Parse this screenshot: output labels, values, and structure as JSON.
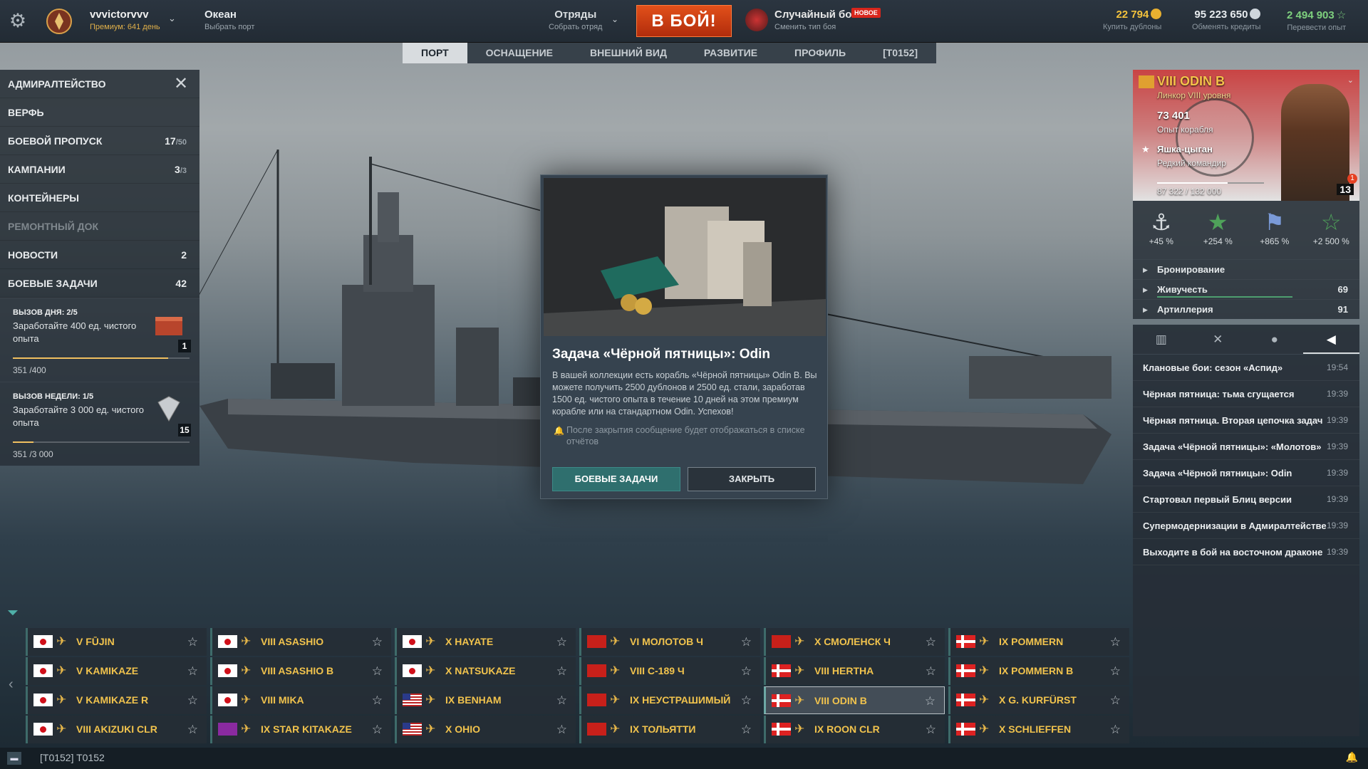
{
  "topbar": {
    "username": "vvvictorvvv",
    "premium": "Премиум: 641 день",
    "map": "Океан",
    "map_sub": "Выбрать порт",
    "division": "Отряды",
    "division_sub": "Собрать отряд",
    "battle": "В БОЙ!",
    "mode": "Случайный бой",
    "mode_sub": "Сменить тип боя",
    "new_badge": "НОВОЕ",
    "doubloons": "22 794",
    "doubloons_sub": "Купить дублоны",
    "credits": "95 223 650",
    "credits_sub": "Обменять кредиты",
    "freexp": "2 494 903",
    "freexp_sub": "Перевести опыт"
  },
  "tabs": [
    "ПОРТ",
    "ОСНАЩЕНИЕ",
    "ВНЕШНИЙ ВИД",
    "РАЗВИТИЕ",
    "ПРОФИЛЬ",
    "[T0152]"
  ],
  "left_menu": {
    "admiralty": "АДМИРАЛТЕЙСТВО",
    "shipyard": "ВЕРФЬ",
    "battlepass": "БОЕВОЙ ПРОПУСК",
    "battlepass_cnt": "17",
    "battlepass_tot": "/50",
    "campaigns": "КАМПАНИИ",
    "campaigns_cnt": "3",
    "campaigns_tot": "/3",
    "containers": "КОНТЕЙНЕРЫ",
    "drydock": "РЕМОНТНЫЙ ДОК",
    "news": "НОВОСТИ",
    "news_cnt": "2",
    "tasks": "БОЕВЫЕ ЗАДАЧИ",
    "tasks_cnt": "42"
  },
  "challenges": [
    {
      "title": "ВЫЗОВ ДНЯ: 2/5",
      "desc": "Заработайте 400 ед. чистого опыта",
      "progress": "351 /400",
      "fraction": 0.8775,
      "level": "1"
    },
    {
      "title": "ВЫЗОВ НЕДЕЛИ: 1/5",
      "desc": "Заработайте 3 000 ед. чистого опыта",
      "progress": "351 /3 000",
      "fraction": 0.117,
      "level": "15"
    }
  ],
  "popup": {
    "title": "Задача «Чёрной пятницы»: Odin",
    "body": "В вашей коллекции есть корабль «Чёрной пятницы» Odin B. Вы можете получить 2500 дублонов и 2500 ед. стали, заработав 1500 ед. чистого опыта в течение 10 дней на этом премиум корабле или на стандартном Odin. Успехов!",
    "note": "После закрытия сообщение будет отображаться в списке отчётов",
    "btn_primary": "БОЕВЫЕ ЗАДАЧИ",
    "btn_secondary": "ЗАКРЫТЬ"
  },
  "ship": {
    "name": "VIII ODIN B",
    "sub": "Линкор VIII уровня",
    "xp": "73 401",
    "xp_label": "Опыт корабля",
    "commander": "Яшка-цыган",
    "commander_rank": "Редкий командир",
    "cmd_progress": "87 322 / 132 000",
    "cmd_fraction": 0.66,
    "cmd_level": "13",
    "notif": "1"
  },
  "bonuses": [
    {
      "icon": "anchor-icon",
      "value": "+45 %"
    },
    {
      "icon": "star-icon",
      "value": "+254 %"
    },
    {
      "icon": "flag-icon",
      "value": "+865 %"
    },
    {
      "icon": "star-icon",
      "value": "+2 500 %"
    }
  ],
  "stats": [
    {
      "name": "Бронирование",
      "value": ""
    },
    {
      "name": "Живучесть",
      "value": "69"
    },
    {
      "name": "Артиллерия",
      "value": "91"
    }
  ],
  "news": [
    {
      "t": "Клановые бои: сезон «Аспид»",
      "time": "19:54"
    },
    {
      "t": "Чёрная пятница: тьма сгущается",
      "time": "19:39"
    },
    {
      "t": "Чёрная пятница. Вторая цепочка задач",
      "time": "19:39"
    },
    {
      "t": "Задача «Чёрной пятницы»: «Молотов»",
      "time": "19:39"
    },
    {
      "t": "Задача «Чёрной пятницы»: Odin",
      "time": "19:39"
    },
    {
      "t": "Стартовал первый Блиц версии",
      "time": "19:39"
    },
    {
      "t": "Супермодернизации в Адмиралтействе",
      "time": "19:39"
    },
    {
      "t": "Выходите в бой на восточном драконе",
      "time": "19:39"
    }
  ],
  "carousel": [
    [
      "V FŪJIN",
      "VIII ASASHIO",
      "X HAYATE",
      "VI МОЛОТОВ Ч",
      "X СМОЛЕНСК Ч",
      "IX POMMERN"
    ],
    [
      "V KAMIKAZE",
      "VIII ASASHIO B",
      "X NATSUKAZE",
      "VIII С-189 Ч",
      "VIII HERTHA",
      "IX POMMERN B"
    ],
    [
      "V KAMIKAZE R",
      "VIII MIKA",
      "IX BENHAM",
      "IX НЕУСТРАШИМЫЙ",
      "VIII ODIN B",
      "X G. KURFÜRST"
    ],
    [
      "VIII AKIZUKI CLR",
      "IX STAR KITAKAZE",
      "X OHIO",
      "IX ТОЛЬЯТТИ",
      "IX ROON CLR",
      "X SCHLIEFFEN"
    ]
  ],
  "carousel_flags": [
    [
      "jp",
      "jp",
      "jp",
      "ussr",
      "ussr",
      "de"
    ],
    [
      "jp",
      "jp",
      "jp",
      "ussr",
      "de",
      "de"
    ],
    [
      "jp",
      "jp",
      "us",
      "ussr",
      "de",
      "de"
    ],
    [
      "jp",
      "star",
      "us",
      "ussr",
      "de",
      "de"
    ]
  ],
  "clan": "[T0152] T0152",
  "colors": {
    "accent": "#2f6f6e",
    "battle": "#d4451a",
    "gold": "#f1c34d"
  }
}
